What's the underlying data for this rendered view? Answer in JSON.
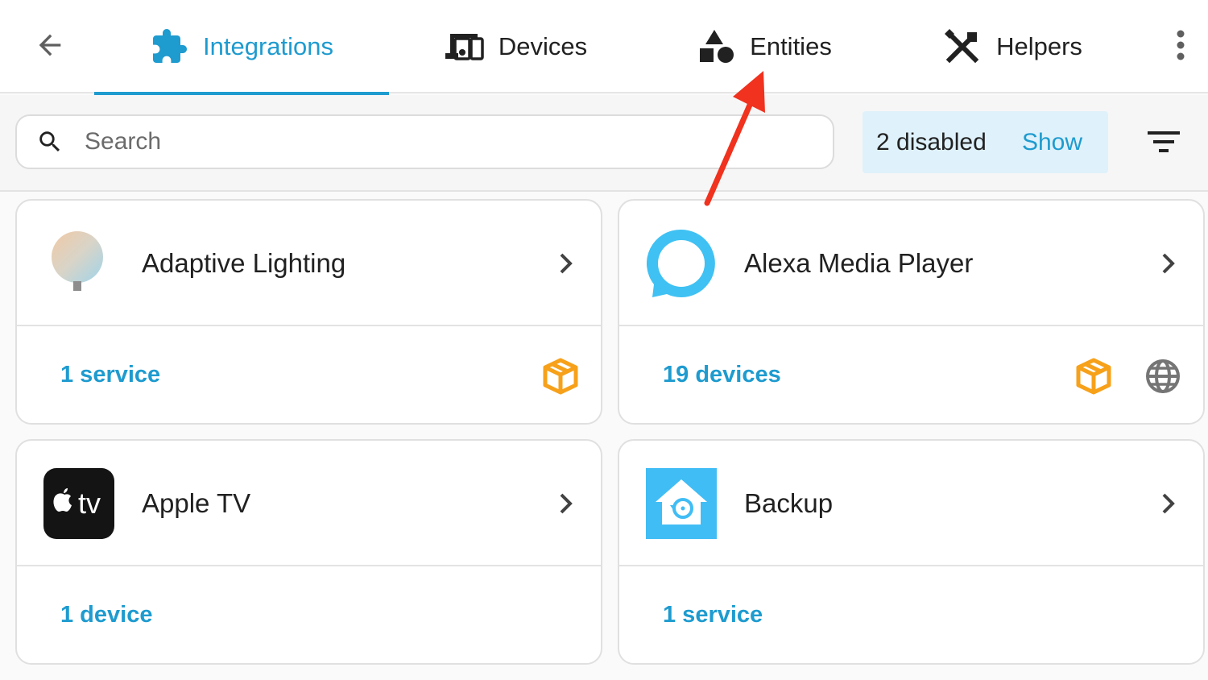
{
  "nav": {
    "back_icon": "arrow-left-icon",
    "tabs": [
      {
        "label": "Integrations",
        "icon": "puzzle-icon",
        "active": true
      },
      {
        "label": "Devices",
        "icon": "devices-icon",
        "active": false
      },
      {
        "label": "Entities",
        "icon": "shapes-icon",
        "active": false
      },
      {
        "label": "Helpers",
        "icon": "tools-icon",
        "active": false
      }
    ],
    "more_icon": "dots-vertical-icon"
  },
  "search": {
    "placeholder": "Search",
    "value": ""
  },
  "disabled": {
    "label": "2 disabled",
    "action": "Show"
  },
  "integrations": [
    {
      "name": "Adaptive Lighting",
      "count": "1 service",
      "logo": "adaptive-lighting-logo",
      "badges": [
        "custom-integration-icon"
      ]
    },
    {
      "name": "Alexa Media Player",
      "count": "19 devices",
      "logo": "alexa-logo",
      "badges": [
        "custom-integration-icon",
        "cloud-globe-icon"
      ]
    },
    {
      "name": "Apple TV",
      "count": "1 device",
      "logo": "apple-tv-logo",
      "badges": []
    },
    {
      "name": "Backup",
      "count": "1 service",
      "logo": "backup-logo",
      "badges": []
    }
  ],
  "colors": {
    "accent": "#1e9bcf",
    "custom_badge": "#f7a11a",
    "annotation_arrow": "#f0321e"
  }
}
